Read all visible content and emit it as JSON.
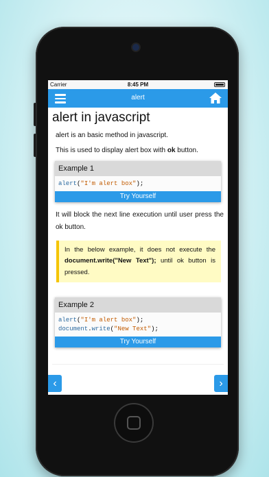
{
  "statusbar": {
    "carrier": "Carrier",
    "time": "8:45 PM"
  },
  "navbar": {
    "title": "alert"
  },
  "page": {
    "heading": "alert in javascript",
    "intro1": "alert is an basic method in javascript.",
    "intro2_prefix": "This is used to display alert box with ",
    "intro2_bold": "ok",
    "intro2_suffix": " button.",
    "para2": "It will block the next line execution until user press the ok button."
  },
  "example1": {
    "title": "Example 1",
    "code": [
      {
        "fn": "alert",
        "open": "(",
        "str": "\"I'm alert box\"",
        "close": ");"
      }
    ],
    "button": "Try Yourself"
  },
  "note": {
    "prefix": "In the below example, it does not execute the ",
    "bold": "document.write(\"New Text\");",
    "suffix": " until ok button is pressed."
  },
  "example2": {
    "title": "Example 2",
    "line1": {
      "fn": "alert",
      "open": "(",
      "str": "\"I'm alert box\"",
      "close": ");"
    },
    "line2": {
      "obj": "document",
      "dot": ".",
      "fn": "write",
      "open": "(",
      "str": "\"New Text\"",
      "close": ");"
    },
    "button": "Try Yourself"
  },
  "nav_arrows": {
    "prev": "‹",
    "next": "›"
  },
  "colors": {
    "accent": "#2b9ae8",
    "note_bg": "#fffbc4",
    "note_border": "#f5c400"
  }
}
